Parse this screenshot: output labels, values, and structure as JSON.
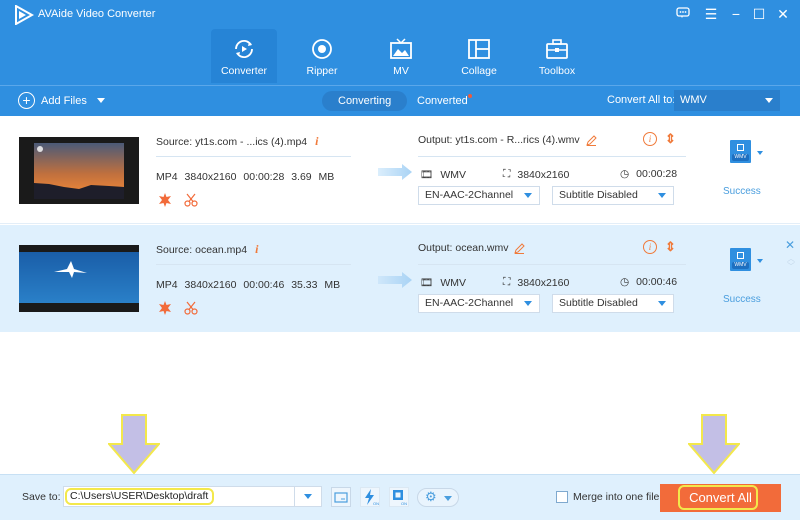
{
  "app": {
    "title": "AVAide Video Converter",
    "window_controls": [
      "feedback-icon",
      "menu-icon",
      "minimize-icon",
      "maximize-icon",
      "close-icon"
    ]
  },
  "nav": {
    "tabs": [
      {
        "label": "Converter",
        "icon": "converter-icon",
        "active": true
      },
      {
        "label": "Ripper",
        "icon": "ripper-icon",
        "active": false
      },
      {
        "label": "MV",
        "icon": "mv-icon",
        "active": false
      },
      {
        "label": "Collage",
        "icon": "collage-icon",
        "active": false
      },
      {
        "label": "Toolbox",
        "icon": "toolbox-icon",
        "active": false
      }
    ]
  },
  "toolbar": {
    "add_files": "Add Files",
    "converting": "Converting",
    "converted": "Converted",
    "convert_all_to_label": "Convert All to:",
    "convert_all_to_value": "WMV"
  },
  "files": [
    {
      "source": "Source: yt1s.com - ...ics (4).mp4",
      "format": "MP4",
      "resolution": "3840x2160",
      "duration": "00:00:28",
      "size": "3.69 MB",
      "output": "Output: yt1s.com - R...rics (4).wmv",
      "out_format": "WMV",
      "out_resolution": "3840x2160",
      "out_duration": "00:00:28",
      "audio": "EN-AAC-2Channel",
      "subtitle": "Subtitle Disabled",
      "status": "Success",
      "format_badge": "WMV"
    },
    {
      "source": "Source: ocean.mp4",
      "format": "MP4",
      "resolution": "3840x2160",
      "duration": "00:00:46",
      "size": "35.33 MB",
      "output": "Output: ocean.wmv",
      "out_format": "WMV",
      "out_resolution": "3840x2160",
      "out_duration": "00:00:46",
      "audio": "EN-AAC-2Channel",
      "subtitle": "Subtitle Disabled",
      "status": "Success",
      "format_badge": "WMV"
    }
  ],
  "bottom": {
    "save_to_label": "Save to:",
    "save_path": "C:\\Users\\USER\\Desktop\\draft",
    "merge_label": "Merge into one file",
    "merge_checked": false,
    "convert_all": "Convert All"
  },
  "colors": {
    "brand": "#2f8fe0",
    "accent": "#f26b3a",
    "highlight": "#f3e84b",
    "annotation_arrow": "#c3bfe6"
  }
}
